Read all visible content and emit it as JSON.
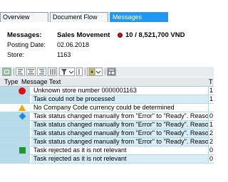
{
  "tabs": [
    {
      "label": "Overview"
    },
    {
      "label": "Document Flow"
    },
    {
      "label": "Messages",
      "active": true
    }
  ],
  "header": {
    "messages_label": "Messages:",
    "messages_value": "Sales Movement",
    "status_amount": "10 / 8,521,700 VND",
    "posting_date_label": "Posting Date:",
    "posting_date_value": "02.06.2018",
    "store_label": "Store:",
    "store_value": "1163"
  },
  "toolbar": {
    "icons": [
      "detail-icon",
      "align-left-icon",
      "align-center-icon",
      "align-right-icon",
      "filter-icon",
      "print-icon",
      "export-icon",
      "layout-icon"
    ]
  },
  "grid": {
    "columns": {
      "type": "Type",
      "text": "Message Text",
      "extra": "T"
    },
    "rows": [
      {
        "icon": "red-circle",
        "text": "Unknown store number 0000001163",
        "extra": "1"
      },
      {
        "icon": "",
        "text": "Task could not be processed",
        "extra": "1"
      },
      {
        "icon": "warning-triangle",
        "text": "No Company Code currency could be determined",
        "extra": ""
      },
      {
        "icon": "blue-diamond",
        "text": "Task status changed manually from \"Error\" to \"Ready\". Reason: -",
        "extra": "0"
      },
      {
        "icon": "",
        "text": "Task status changed manually from \"Error\" to \"Ready\". Reason: -",
        "extra": "1"
      },
      {
        "icon": "",
        "text": "Task status changed manually from \"Error\" to \"Ready\". Reason: -",
        "extra": "2"
      },
      {
        "icon": "",
        "text": "Task status changed manually from \"Error\" to \"Ready\". Reason: -",
        "extra": "2"
      },
      {
        "icon": "green-square",
        "text": "Task rejected as it is not relevant",
        "extra": "0"
      },
      {
        "icon": "",
        "text": "Task rejected as it is not relevant",
        "extra": "0"
      }
    ]
  },
  "colors": {
    "active_tab": "#2196f3",
    "error": "#dd1111",
    "warning": "#f2a400",
    "info": "#1e88e5",
    "success": "#1a9a2a"
  }
}
